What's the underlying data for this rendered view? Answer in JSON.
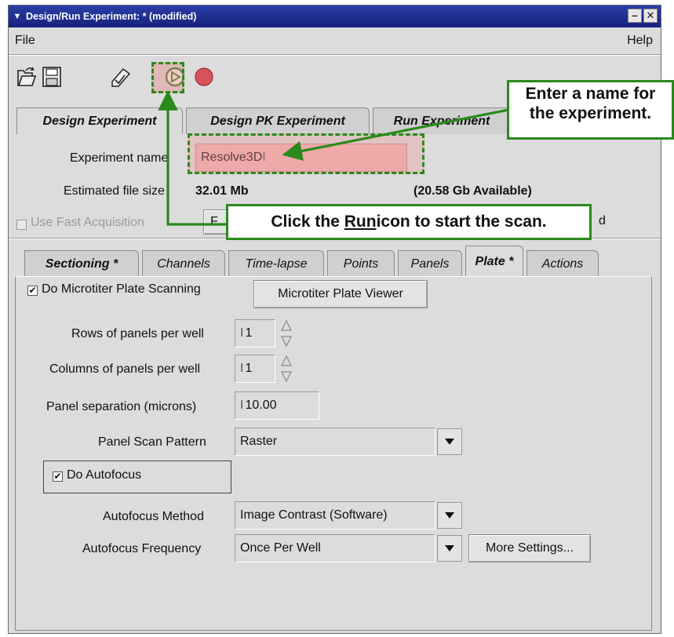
{
  "window": {
    "title": "Design/Run Experiment:  * (modified)",
    "buttons": [
      "–",
      "✕"
    ]
  },
  "menu": {
    "file": "File",
    "help": "Help"
  },
  "main_tabs": [
    {
      "label": "Design Experiment",
      "active": true
    },
    {
      "label": "Design PK Experiment",
      "active": false
    },
    {
      "label": "Run Experiment",
      "active": false
    }
  ],
  "experiment": {
    "name_label": "Experiment name",
    "name_value": "Resolve3D",
    "filesize_label": "Estimated file size",
    "filesize_value": "32.01 Mb",
    "available": "(20.58 Gb Available)",
    "fast_acq_label": "Use Fast Acquisition",
    "hidden_btn_label": "F",
    "hidden_right_fragment": "d"
  },
  "sub_tabs": [
    {
      "label": "Sectioning *",
      "active": false,
      "bold": true
    },
    {
      "label": "Channels",
      "active": false
    },
    {
      "label": "Time-lapse",
      "active": false
    },
    {
      "label": "Points",
      "active": false
    },
    {
      "label": "Panels",
      "active": false
    },
    {
      "label": "Plate *",
      "active": true,
      "bold": true
    },
    {
      "label": "Actions",
      "active": false
    }
  ],
  "plate": {
    "scan_checkbox_label": "Do Microtiter Plate Scanning",
    "scan_checked": true,
    "viewer_button": "Microtiter Plate Viewer",
    "rows_label": "Rows of panels per well",
    "rows_value": "1",
    "cols_label": "Columns of panels per well",
    "cols_value": "1",
    "separation_label": "Panel separation (microns)",
    "separation_value": "10.00",
    "pattern_label": "Panel Scan Pattern",
    "pattern_value": "Raster",
    "autofocus_label": "Do Autofocus",
    "autofocus_checked": true,
    "method_label": "Autofocus Method",
    "method_value": "Image Contrast (Software)",
    "frequency_label": "Autofocus Frequency",
    "frequency_value": "Once Per Well",
    "more_settings": "More Settings..."
  },
  "callouts": {
    "name_line1": "Enter a name for",
    "name_line2": "the experiment.",
    "run_pre": "Click the ",
    "run_word": "Run",
    "run_post": " icon to start the scan."
  },
  "colors": {
    "callout_border": "#2a8a1c",
    "highlight": "#e68c8c",
    "titlebar": "#1e2e90"
  }
}
